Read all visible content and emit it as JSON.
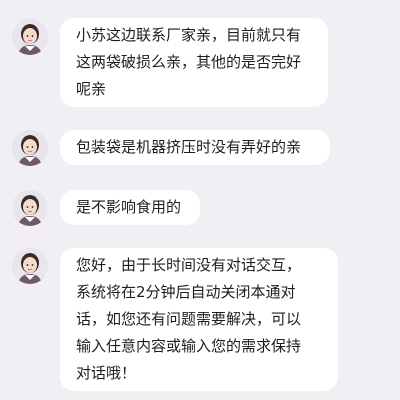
{
  "conversation": {
    "messages": [
      {
        "sender": "agent",
        "avatar_icon": "agent-avatar-icon",
        "lines": [
          "小苏这边联系厂家亲，目前就只有",
          "这两袋破损么亲，其他的是否完好",
          "呢亲"
        ]
      },
      {
        "sender": "agent",
        "avatar_icon": "agent-avatar-icon",
        "lines": [
          "包装袋是机器挤压时没有弄好的亲"
        ]
      },
      {
        "sender": "agent",
        "avatar_icon": "agent-avatar-icon",
        "lines": [
          "是不影响食用的"
        ]
      },
      {
        "sender": "agent",
        "avatar_icon": "agent-avatar-icon",
        "lines": [
          "您好，由于长时间没有对话交互，",
          "系统将在2分钟后自动关闭本通对",
          "话，如您还有问题需要解决，可以",
          "输入任意内容或输入您的需求保持",
          "对话哦！"
        ]
      }
    ]
  },
  "colors": {
    "background": "#f2eff4",
    "bubble": "#ffffff",
    "text": "#1e1e1e"
  }
}
